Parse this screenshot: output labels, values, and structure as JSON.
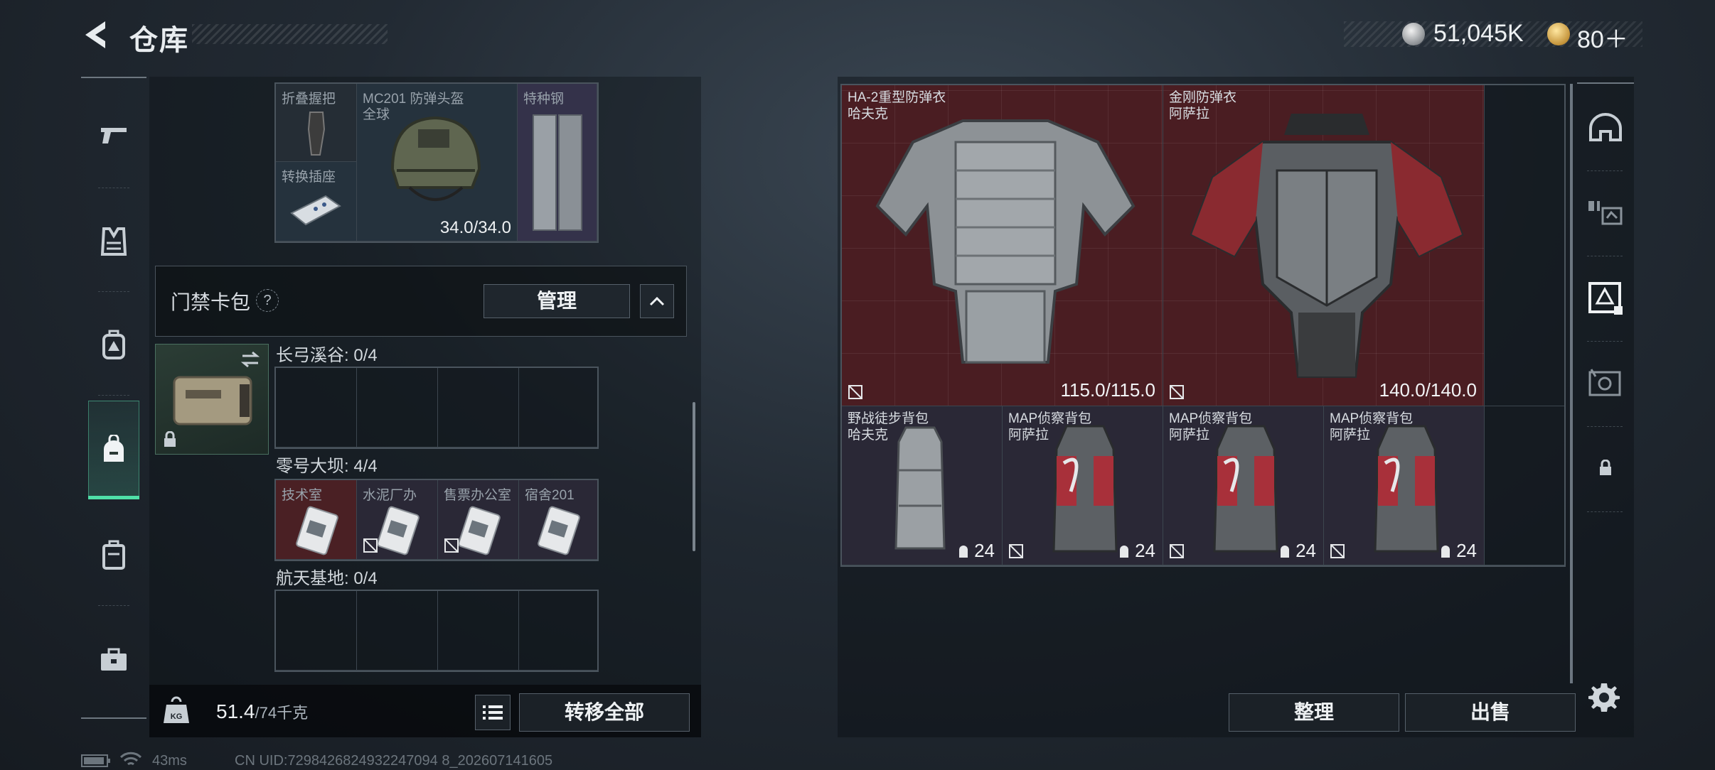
{
  "header": {
    "title": "仓库",
    "currency_silver": "51,045K",
    "currency_gold": "80＋"
  },
  "rail": {
    "items": [
      "gun-icon",
      "vest-icon",
      "chest-rig-icon",
      "backpack-icon",
      "bag-icon",
      "toolbox-icon"
    ],
    "active": "backpack-icon"
  },
  "upper_grid": {
    "cells": [
      {
        "label": "折叠握把"
      },
      {
        "label": "MC201 防弹头盔",
        "sub": "全球"
      },
      {
        "label": "特种钢"
      },
      {
        "label": "转换插座"
      }
    ],
    "helmet_durability": "34.0/34.0"
  },
  "card_pack": {
    "title": "门禁卡包",
    "help": "?",
    "manage_label": "管理"
  },
  "regions": [
    {
      "name": "长弓溪谷: 0/4"
    },
    {
      "name": "零号大坝: 4/4",
      "cards": [
        "技术室",
        "水泥厂办",
        "售票办公室",
        "宿舍201"
      ]
    },
    {
      "name": "航天基地: 0/4"
    }
  ],
  "weight": {
    "current": "51.4",
    "max": "/74千克"
  },
  "left_actions": {
    "transfer_all": "转移全部"
  },
  "right_grid": {
    "armors": [
      {
        "name": "HA-2重型防弹衣",
        "brand": "哈夫克",
        "durability": "115.0/115.0"
      },
      {
        "name": "金刚防弹衣",
        "brand": "阿萨拉",
        "durability": "140.0/140.0"
      }
    ],
    "bags": [
      {
        "name": "野战徒步背包",
        "brand": "哈夫克",
        "capacity": "24"
      },
      {
        "name": "MAP侦察背包",
        "brand": "阿萨拉",
        "capacity": "24"
      },
      {
        "name": "MAP侦察背包",
        "brand": "阿萨拉",
        "capacity": "24"
      },
      {
        "name": "MAP侦察背包",
        "brand": "阿萨拉",
        "capacity": "24"
      }
    ]
  },
  "right_actions": {
    "sort": "整理",
    "sell": "出售"
  },
  "right_rail": [
    "helmet-icon",
    "rifle-attachment-icon",
    "armor-case-icon",
    "vault-icon",
    "lock-icon"
  ],
  "status_bar": {
    "ping": "43ms",
    "uid": "CN UID:7298426824932247094 8_202607141605"
  }
}
